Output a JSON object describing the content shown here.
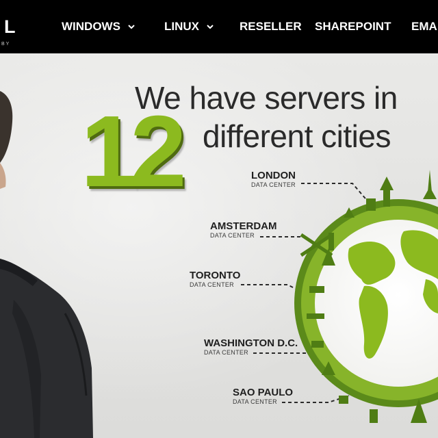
{
  "header": {
    "logo_letter": "L",
    "logo_tagline": "BY",
    "nav": [
      {
        "label": "WINDOWS",
        "has_dropdown": true
      },
      {
        "label": "LINUX",
        "has_dropdown": true
      },
      {
        "label": "RESELLER",
        "has_dropdown": false
      },
      {
        "label": "SHAREPOINT",
        "has_dropdown": false
      },
      {
        "label": "EMA",
        "has_dropdown": false
      }
    ]
  },
  "hero": {
    "headline_line1": "We have servers in",
    "headline_number": "12",
    "headline_line2": "different cities",
    "datacenters": [
      {
        "city": "LONDON",
        "sub": "DATA CENTER"
      },
      {
        "city": "AMSTERDAM",
        "sub": "DATA CENTER"
      },
      {
        "city": "TORONTO",
        "sub": "DATA CENTER"
      },
      {
        "city": "WASHINGTON D.C.",
        "sub": "DATA CENTER"
      },
      {
        "city": "SAO PAULO",
        "sub": "DATA CENTER"
      }
    ]
  },
  "colors": {
    "navbar_bg": "#000000",
    "accent_green": "#8cba1f",
    "text_dark": "#2a2a2a"
  }
}
